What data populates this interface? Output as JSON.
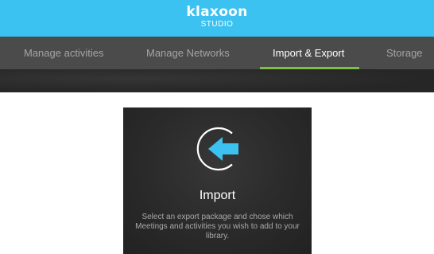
{
  "header": {
    "brand": "klaxoon",
    "subtitle": "STUDIO"
  },
  "nav": {
    "tabs": [
      {
        "label": "Manage activities",
        "active": false
      },
      {
        "label": "Manage Networks",
        "active": false
      },
      {
        "label": "Import & Export",
        "active": true
      },
      {
        "label": "Storage",
        "active": false
      }
    ]
  },
  "import_card": {
    "icon": "import-arrow-icon",
    "title": "Import",
    "description": "Select an export package and chose which Meetings and activities you wish to add to your library."
  },
  "colors": {
    "brand": "#3cc2f0",
    "nav_background": "#4b4b4b",
    "active_underline": "#7bc043",
    "card_background": "#2b2b2b",
    "icon_arrow": "#3cc2f0"
  }
}
